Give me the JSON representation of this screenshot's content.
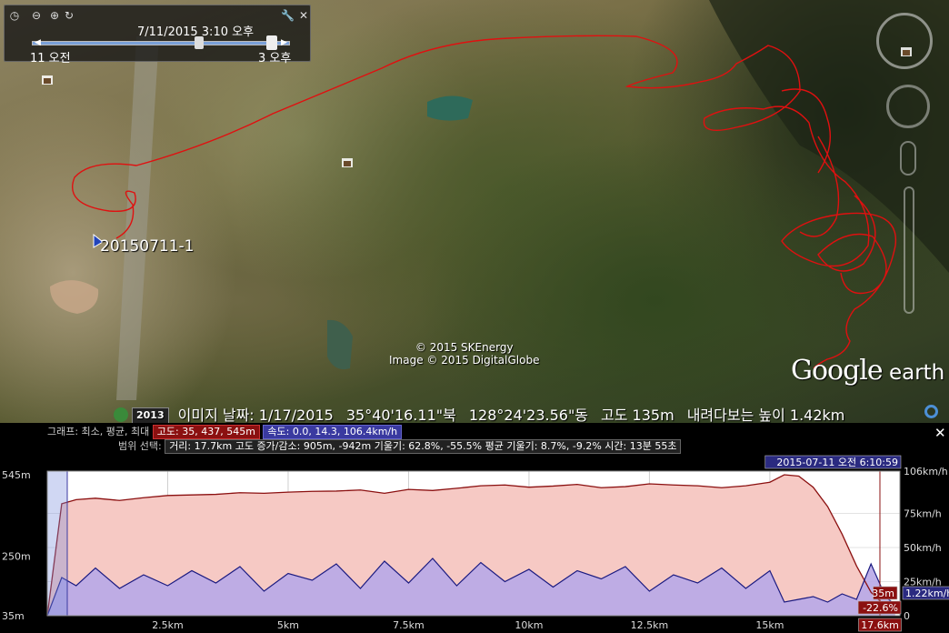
{
  "time_slider": {
    "date_label": "7/11/2015   3:10 오후",
    "start_label": "11 오전",
    "end_label": "3 오후"
  },
  "map": {
    "placemark_label": "20150711-1",
    "copyright_line1": "© 2015 SKEnergy",
    "copyright_line2": "Image © 2015 DigitalGlobe",
    "brand_google": "Google",
    "brand_earth": " earth",
    "track_color": "#e01010"
  },
  "status": {
    "year_badge": "2013",
    "imagery_date": "이미지 날짜: 1/17/2015",
    "lat": "35°40'16.11\"북",
    "lon": "128°24'23.56\"동",
    "elev": "고도   135m",
    "eye_alt": "내려다보는 높이   1.42km"
  },
  "profile": {
    "graph_label": "그래프: 최소, 평균, 최대",
    "altitude_pill": "고도: 35, 437, 545m",
    "speed_pill": "속도: 0.0, 14.3, 106.4km/h",
    "selection_label": "범위 선택:",
    "stats_pill": "거리: 17.7km 고도 증가/감소: 905m, -942m 기울기: 62.8%, -55.5% 평균 기울기: 8.7%, -9.2% 시간: 13분 55초",
    "cursor_time": "2015-07-11 오전 6:10:59",
    "left_axis": [
      "545m",
      "250m",
      "35m"
    ],
    "right_axis": [
      "106km/h",
      "75km/h",
      "50km/h",
      "25km/h",
      "0"
    ],
    "x_ticks": [
      "2.5km",
      "5km",
      "7.5km",
      "10km",
      "12.5km",
      "15km"
    ],
    "end_distance": "17.6km",
    "cursor_alt": "35m",
    "cursor_slope": "-22.6%",
    "cursor_speed": "1.22km/h"
  },
  "chart_data": {
    "type": "area",
    "x_unit": "km",
    "xlim": [
      0,
      17.7
    ],
    "series": [
      {
        "name": "고도",
        "unit": "m",
        "ylim": [
          35,
          545
        ],
        "color": "#8b1010",
        "x": [
          0,
          0.3,
          0.6,
          1.0,
          1.5,
          2.0,
          2.5,
          3.0,
          3.5,
          4.0,
          4.5,
          5.0,
          5.5,
          6.0,
          6.5,
          7.0,
          7.5,
          8.0,
          8.5,
          9.0,
          9.5,
          10.0,
          10.5,
          11.0,
          11.5,
          12.0,
          12.5,
          13.0,
          13.5,
          14.0,
          14.5,
          15.0,
          15.3,
          15.6,
          15.9,
          16.2,
          16.5,
          16.8,
          17.1,
          17.4,
          17.6
        ],
        "values": [
          35,
          440,
          455,
          460,
          452,
          462,
          470,
          472,
          474,
          480,
          478,
          482,
          485,
          486,
          490,
          478,
          492,
          488,
          496,
          505,
          508,
          500,
          504,
          510,
          498,
          502,
          512,
          508,
          505,
          498,
          505,
          518,
          545,
          540,
          500,
          430,
          330,
          215,
          120,
          70,
          60
        ]
      },
      {
        "name": "속도",
        "unit": "km/h",
        "ylim": [
          0,
          106
        ],
        "color": "#1a1a80",
        "x": [
          0,
          0.3,
          0.6,
          1.0,
          1.5,
          2.0,
          2.5,
          3.0,
          3.5,
          4.0,
          4.5,
          5.0,
          5.5,
          6.0,
          6.5,
          7.0,
          7.5,
          8.0,
          8.5,
          9.0,
          9.5,
          10.0,
          10.5,
          11.0,
          11.5,
          12.0,
          12.5,
          13.0,
          13.5,
          14.0,
          14.5,
          15.0,
          15.3,
          15.6,
          15.9,
          16.2,
          16.5,
          16.8,
          17.1,
          17.4,
          17.6
        ],
        "values": [
          0,
          28,
          22,
          35,
          20,
          30,
          22,
          33,
          24,
          36,
          18,
          31,
          26,
          38,
          20,
          40,
          24,
          42,
          22,
          39,
          25,
          34,
          21,
          33,
          27,
          36,
          18,
          30,
          24,
          35,
          20,
          33,
          10,
          12,
          14,
          10,
          16,
          12,
          38,
          14,
          8
        ]
      }
    ]
  }
}
